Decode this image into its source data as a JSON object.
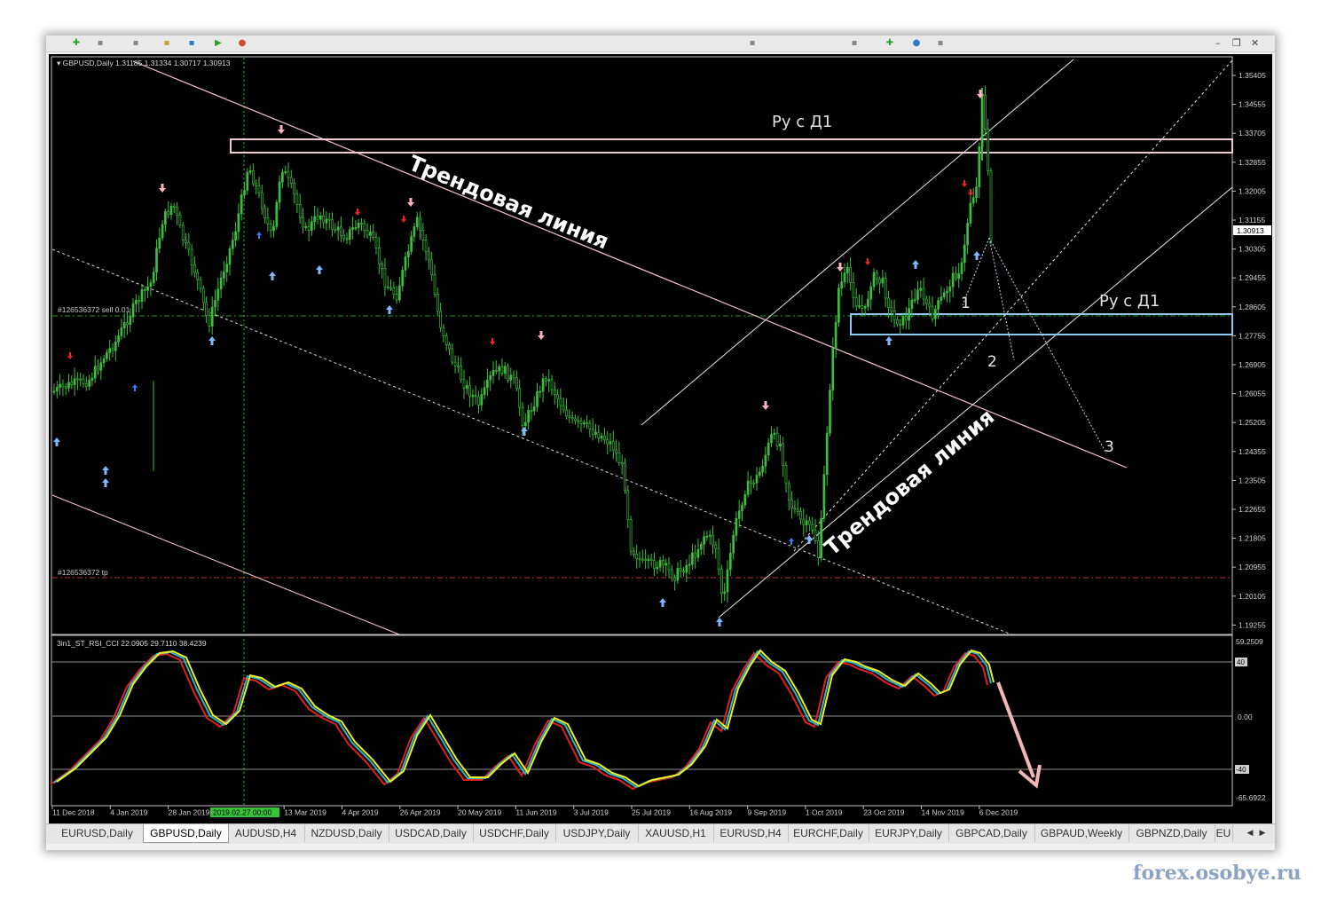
{
  "chart_header": "GBPUSD,Daily  1.31185 1.31334 1.30717 1.30913",
  "indicator_header": "3in1_ST_RSI_CCI 22.0905 29.7110 38.4239",
  "order_labels": {
    "sell": "#126536372 sell 0.01",
    "tp": "#126536372 tp"
  },
  "price_axis": [
    "1.35405",
    "1.34555",
    "1.33705",
    "1.32855",
    "1.32005",
    "1.31155",
    "1.30305",
    "1.29455",
    "1.28605",
    "1.27755",
    "1.26905",
    "1.26055",
    "1.25205",
    "1.24355",
    "1.23505",
    "1.22655",
    "1.21805",
    "1.20955",
    "1.20105",
    "1.19255"
  ],
  "current_price": "1.30913",
  "indicator_axis": {
    "top": "59.2509",
    "p40": "40",
    "zero": "0.00",
    "m40": "-40",
    "bottom": "-65.6922"
  },
  "date_axis": [
    "11 Dec 2018",
    "4 Jan 2019",
    "28 Jan 2019",
    "",
    "13 Mar 2019",
    "4 Apr 2019",
    "26 Apr 2019",
    "20 May 2019",
    "11 Jun 2019",
    "3 Jul 2019",
    "25 Jul 2019",
    "16 Aug 2019",
    "9 Sep 2019",
    "1 Oct 2019",
    "23 Oct 2019",
    "14 Nov 2019",
    "6 Dec 2019"
  ],
  "crosshair_date": "2019.02.27 00:00",
  "annotations": {
    "trend_down": "Трендовая линия",
    "trend_up": "Трендовая линия",
    "level_top": "Ру с Д1",
    "level_bottom": "Ру с Д1",
    "wave1": "1",
    "wave2": "2",
    "wave3": "3"
  },
  "tabs": [
    "EURUSD,Daily",
    "GBPUSD,Daily",
    "AUDUSD,H4",
    "NZDUSD,Daily",
    "USDCAD,Daily",
    "USDCHF,Daily",
    "USDJPY,Daily",
    "XAUUSD,H1",
    "EURUSD,H4",
    "EURCHF,Daily",
    "EURJPY,Daily",
    "GBPCAD,Daily",
    "GBPAUD,Weekly",
    "GBPNZD,Daily",
    "EU"
  ],
  "active_tab": "GBPUSD,Daily",
  "watermark": "forex.osobye.ru",
  "colors": {
    "background": "#000000",
    "candle": "#3cbd3c",
    "grid_axis": "#c0c0c0",
    "trend_line": "#f3c6c6",
    "channel_line": "#e8e8e8",
    "level_top_box": "#f0c8d8",
    "level_bottom_box": "#8ec8f0",
    "sell_line": "#1f9e1f",
    "tp_line": "#c03030",
    "fractal_up": "#7fb8ff",
    "fractal_down": "#ffb0c0",
    "arrow_up_small": "#3a7cff",
    "arrow_down_small": "#ff2020",
    "ind_rsi": "#e02020",
    "ind_cci": "#35b0c0",
    "ind_st": "#f0f020",
    "forecast_arrow": "#f2b6b6"
  }
}
